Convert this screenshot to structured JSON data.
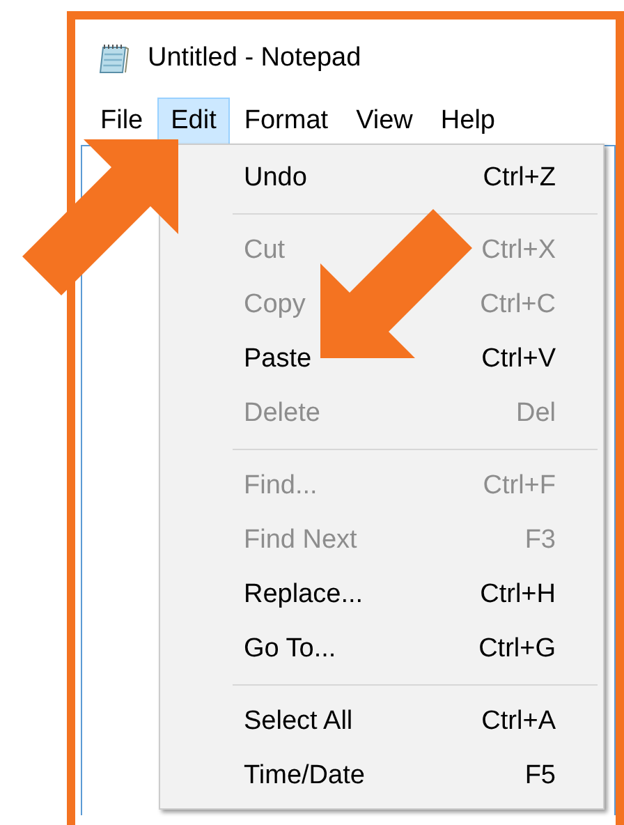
{
  "window": {
    "title": "Untitled - Notepad"
  },
  "menu_bar": [
    {
      "label": "File",
      "selected": false
    },
    {
      "label": "Edit",
      "selected": true
    },
    {
      "label": "Format",
      "selected": false
    },
    {
      "label": "View",
      "selected": false
    },
    {
      "label": "Help",
      "selected": false
    }
  ],
  "edit_menu": {
    "items": [
      {
        "kind": "item",
        "label": "Undo",
        "shortcut": "Ctrl+Z",
        "disabled": false
      },
      {
        "kind": "separator"
      },
      {
        "kind": "item",
        "label": "Cut",
        "shortcut": "Ctrl+X",
        "disabled": true
      },
      {
        "kind": "item",
        "label": "Copy",
        "shortcut": "Ctrl+C",
        "disabled": true
      },
      {
        "kind": "item",
        "label": "Paste",
        "shortcut": "Ctrl+V",
        "disabled": false
      },
      {
        "kind": "item",
        "label": "Delete",
        "shortcut": "Del",
        "disabled": true
      },
      {
        "kind": "separator"
      },
      {
        "kind": "item",
        "label": "Find...",
        "shortcut": "Ctrl+F",
        "disabled": true
      },
      {
        "kind": "item",
        "label": "Find Next",
        "shortcut": "F3",
        "disabled": true
      },
      {
        "kind": "item",
        "label": "Replace...",
        "shortcut": "Ctrl+H",
        "disabled": false
      },
      {
        "kind": "item",
        "label": "Go To...",
        "shortcut": "Ctrl+G",
        "disabled": false
      },
      {
        "kind": "separator"
      },
      {
        "kind": "item",
        "label": "Select All",
        "shortcut": "Ctrl+A",
        "disabled": false
      },
      {
        "kind": "item",
        "label": "Time/Date",
        "shortcut": "F5",
        "disabled": false
      }
    ]
  },
  "annotations": [
    {
      "kind": "arrow"
    },
    {
      "kind": "arrow"
    }
  ]
}
